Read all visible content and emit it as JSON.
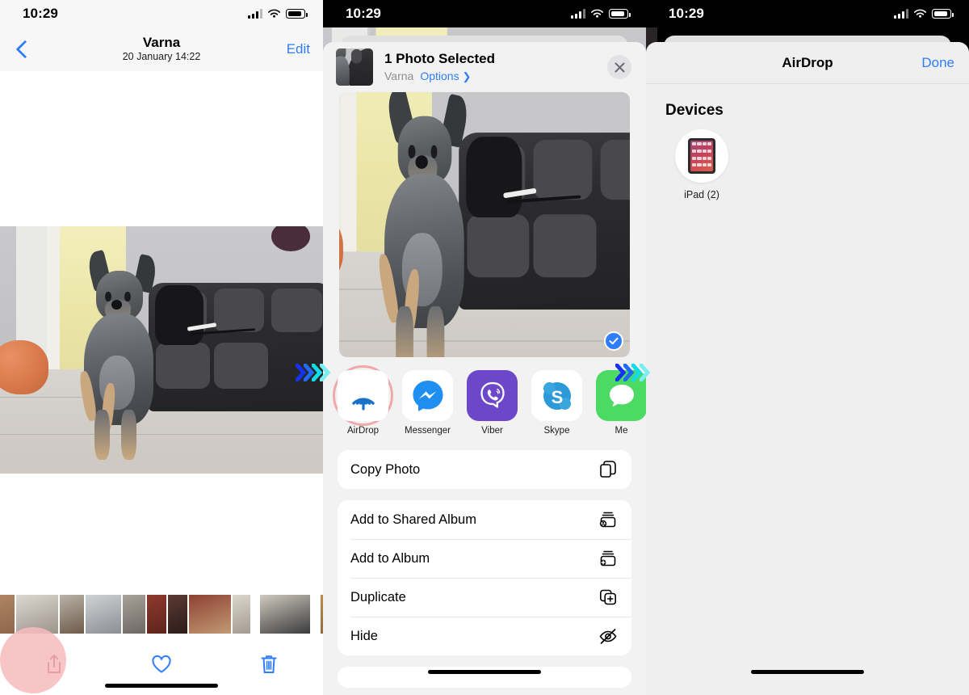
{
  "statusbar": {
    "time": "10:29",
    "signal_icon": "cellular-bars-icon",
    "wifi_icon": "wifi-icon",
    "battery_icon": "battery-icon"
  },
  "panel1": {
    "name": "photo-detail-screen",
    "nav": {
      "back_icon": "chevron-left-icon",
      "title": "Varna",
      "subtitle": "20 January  14:22",
      "edit_label": "Edit"
    },
    "toolbar": {
      "share_icon": "share-icon",
      "favorite_icon": "heart-icon",
      "delete_icon": "trash-icon",
      "highlight_color": "#f7bbbd"
    }
  },
  "panel2": {
    "name": "share-sheet-screen",
    "header": {
      "title": "1 Photo Selected",
      "album": "Varna",
      "options_label": "Options",
      "options_chevron": "chevron-right-icon",
      "close_icon": "close-icon"
    },
    "preview": {
      "selected_icon": "check-circle-icon",
      "selected": true
    },
    "apps": [
      {
        "name": "AirDrop",
        "icon": "airdrop-icon",
        "highlighted": true,
        "bg": "#ffffff",
        "fg": "#1a72c8"
      },
      {
        "name": "Messenger",
        "icon": "messenger-icon",
        "highlighted": false,
        "bg": "#ffffff",
        "fg": "#1f8ef1"
      },
      {
        "name": "Viber",
        "icon": "viber-icon",
        "highlighted": false,
        "bg": "#6c48c9",
        "fg": "#ffffff"
      },
      {
        "name": "Skype",
        "icon": "skype-icon",
        "highlighted": false,
        "bg": "#ffffff",
        "fg": "#2b9ad6"
      },
      {
        "name": "Me",
        "icon": "messages-icon",
        "highlighted": false,
        "bg": "#4cd964",
        "fg": "#ffffff"
      }
    ],
    "actions_group1": [
      {
        "label": "Copy Photo",
        "icon": "copy-icon"
      }
    ],
    "actions_group2": [
      {
        "label": "Add to Shared Album",
        "icon": "shared-album-icon"
      },
      {
        "label": "Add to Album",
        "icon": "add-album-icon"
      },
      {
        "label": "Duplicate",
        "icon": "duplicate-icon"
      },
      {
        "label": "Hide",
        "icon": "hide-eye-icon"
      }
    ],
    "highlight_color": "#f0a9ab"
  },
  "panel3": {
    "name": "airdrop-screen",
    "header": {
      "title": "AirDrop",
      "done_label": "Done"
    },
    "section_title": "Devices",
    "devices": [
      {
        "name": "iPad (2)",
        "icon": "ipad-icon"
      }
    ]
  },
  "arrows": {
    "name": "flow-arrows",
    "colors": [
      "#1731f0",
      "#1f6bf5",
      "#10dce6",
      "#7beef2"
    ]
  }
}
